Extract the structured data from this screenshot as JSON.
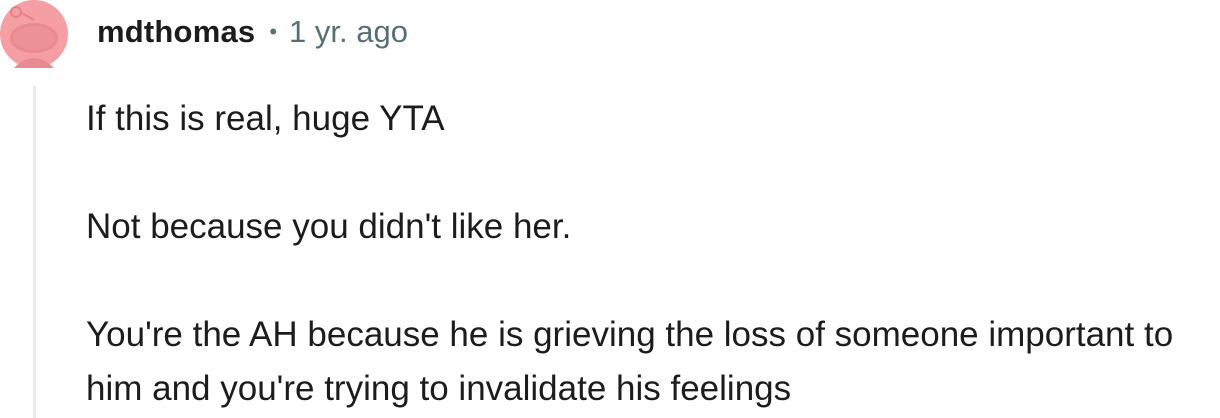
{
  "comment": {
    "author": "mdthomas",
    "separator": "•",
    "timestamp": "1 yr. ago",
    "avatar_icon": "reddit-snoo-avatar-icon",
    "avatar_color": "#f59ea3",
    "paragraphs": [
      "If this is real, huge YTA",
      "Not because you didn't like her.",
      "You're the AH because he is grieving the loss of someone important to him and you're trying to invalidate his feelings"
    ]
  },
  "colors": {
    "text": "#1c1c1c",
    "meta": "#576f76",
    "thread_line": "#e5ebee"
  }
}
